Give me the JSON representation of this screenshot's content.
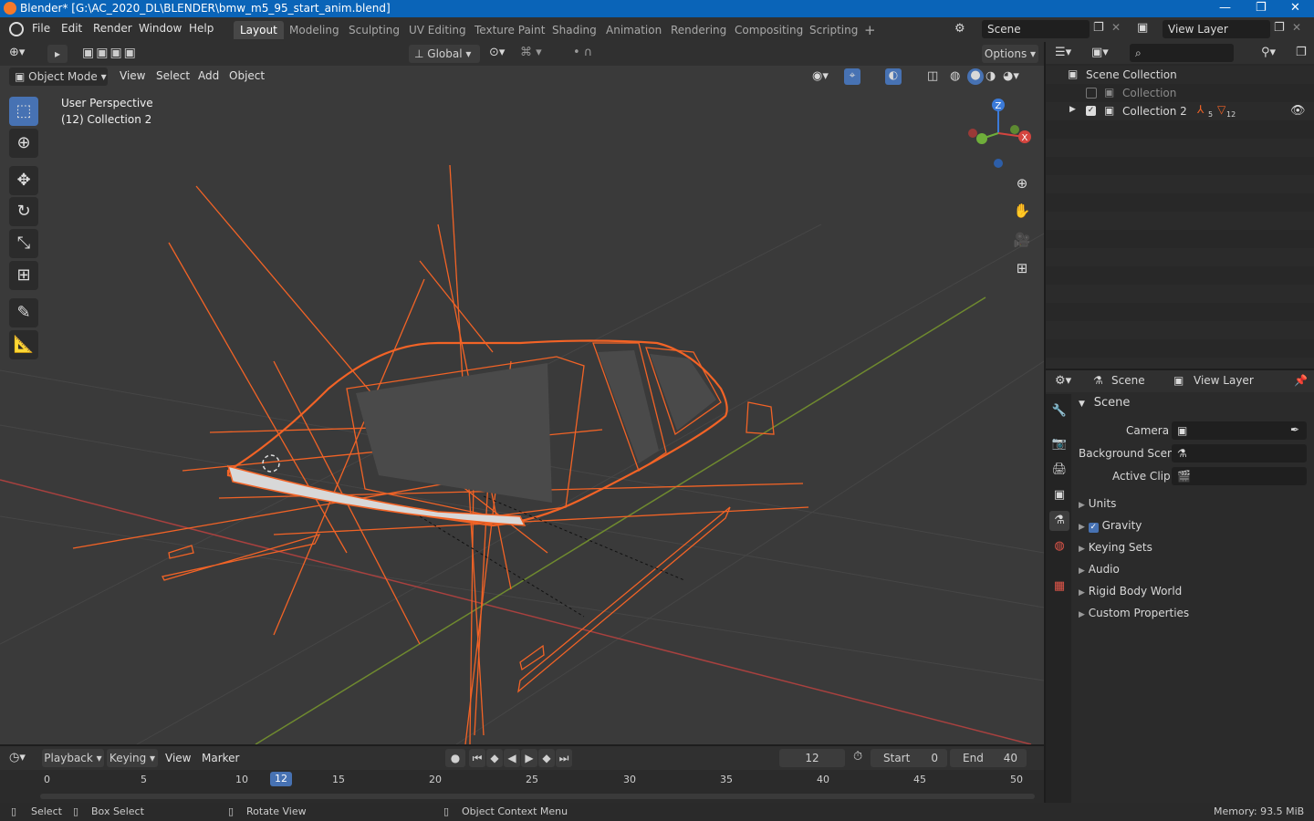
{
  "window": {
    "title": "Blender* [G:\\AC_2020_DL\\BLENDER\\bmw_m5_95_start_anim.blend]",
    "minimize": "—",
    "maximize": "❐",
    "close": "✕"
  },
  "menu": {
    "file": "File",
    "edit": "Edit",
    "render": "Render",
    "window": "Window",
    "help": "Help"
  },
  "workspaces": [
    "Layout",
    "Modeling",
    "Sculpting",
    "UV Editing",
    "Texture Paint",
    "Shading",
    "Animation",
    "Rendering",
    "Compositing",
    "Scripting"
  ],
  "workspace_add": "+",
  "scene": {
    "name": "Scene",
    "view_layer": "View Layer"
  },
  "viewport": {
    "mode": "Object Mode",
    "menus": {
      "view": "View",
      "select": "Select",
      "add": "Add",
      "object": "Object"
    },
    "transform_orientation": "Global",
    "options": "Options",
    "perspective_label": "User Perspective",
    "collection_label": "(12) Collection 2",
    "gizmo": {
      "x": "X",
      "y": "Y",
      "z": "Z"
    }
  },
  "outliner": {
    "root": "Scene Collection",
    "items": [
      {
        "label": "Collection"
      },
      {
        "label": "Collection 2",
        "badge1": "5",
        "badge2": "12"
      }
    ]
  },
  "properties": {
    "header_scene": "Scene",
    "header_view_layer": "View Layer",
    "panel_title": "Scene",
    "fields": {
      "camera": "Camera",
      "background_scene": "Background Scen",
      "active_clip": "Active Clip"
    },
    "subpanels": [
      "Units",
      "Gravity",
      "Keying Sets",
      "Audio",
      "Rigid Body World",
      "Custom Properties"
    ]
  },
  "timeline": {
    "menus": {
      "playback": "Playback",
      "keying": "Keying",
      "view": "View",
      "marker": "Marker"
    },
    "current_frame": "12",
    "start_label": "Start",
    "start": "0",
    "end_label": "End",
    "end": "40",
    "ticks": [
      "0",
      "5",
      "10",
      "15",
      "20",
      "25",
      "30",
      "35",
      "40",
      "45",
      "50"
    ],
    "playhead": "12"
  },
  "status": {
    "select": "Select",
    "box_select": "Box Select",
    "rotate_view": "Rotate View",
    "context_menu": "Object Context Menu",
    "memory": "Memory: 93.5 MiB"
  },
  "colors": {
    "accent": "#4772b3",
    "selection": "#f26326",
    "title_bar": "#0a64b8",
    "x_axis": "#a8413f",
    "y_axis": "#6f8a2f"
  }
}
